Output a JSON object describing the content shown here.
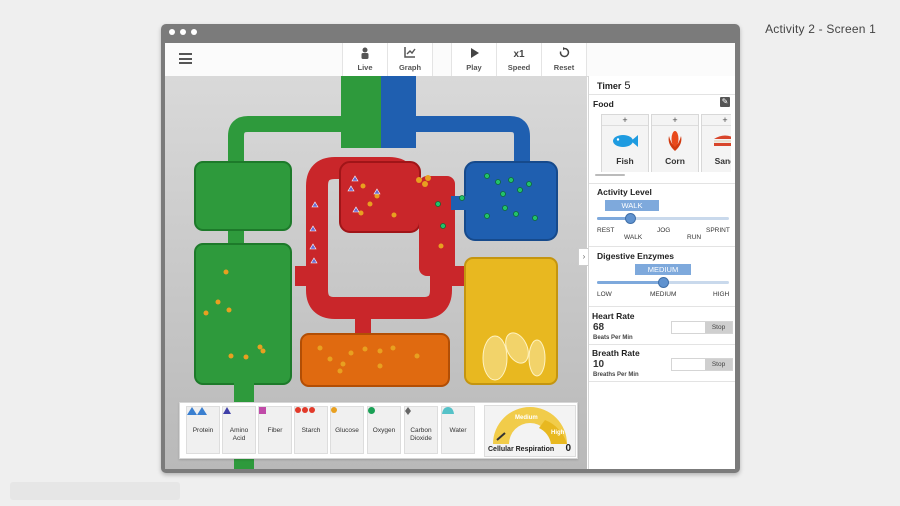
{
  "screen_label": "Activity 2 - Screen 1",
  "toolbar": {
    "live": "Live",
    "graph": "Graph",
    "play": "Play",
    "speed_value": "x1",
    "speed": "Speed",
    "reset": "Reset"
  },
  "panel": {
    "timer_label": "Timer",
    "timer_value": "5",
    "food_title": "Food",
    "foods": [
      {
        "name": "Fish",
        "plus": "+",
        "icon": "fish-icon",
        "color": "#1e9be0"
      },
      {
        "name": "Corn",
        "plus": "+",
        "icon": "corn-icon",
        "color": "#e84a1c"
      },
      {
        "name": "Sand",
        "plus": "+",
        "icon": "sandwich-icon",
        "color": "#d8452b"
      }
    ],
    "activity": {
      "title": "Activity Level",
      "value": "WALK",
      "ticks": [
        "REST",
        "JOG",
        "SPRINT"
      ],
      "ticks_lower": [
        "WALK",
        "RUN"
      ],
      "level": 0.25
    },
    "enzymes": {
      "title": "Digestive Enzymes",
      "value": "MEDIUM",
      "ticks": [
        "LOW",
        "MEDIUM",
        "HIGH"
      ],
      "level": 0.5
    },
    "heart": {
      "title": "Heart Rate",
      "value": "68",
      "unit": "Beats Per Min",
      "stop": "Stop"
    },
    "breath": {
      "title": "Breath Rate",
      "value": "10",
      "unit": "Breaths Per Min",
      "stop": "Stop"
    }
  },
  "legend": {
    "items": [
      {
        "label": "Protein",
        "color": "#3a7fd0",
        "icon": "protein-icon"
      },
      {
        "label": "Amino Acid",
        "color": "#3f3fa8",
        "icon": "amino-acid-icon"
      },
      {
        "label": "Fiber",
        "color": "#c04aa8",
        "icon": "fiber-icon"
      },
      {
        "label": "Starch",
        "color": "#e23a2a",
        "icon": "starch-icon"
      },
      {
        "label": "Glucose",
        "color": "#e8a020",
        "icon": "glucose-icon"
      },
      {
        "label": "Oxygen",
        "color": "#1aa055",
        "icon": "oxygen-icon"
      },
      {
        "label": "Carbon Dioxide",
        "color": "#666666",
        "icon": "carbon-dioxide-icon"
      },
      {
        "label": "Water",
        "color": "#55c2c8",
        "icon": "water-icon"
      }
    ],
    "gauge": {
      "label": "Cellular Respiration",
      "value": "0",
      "band_medium": "Medium",
      "band_high": "High"
    }
  },
  "colors": {
    "lungs": "#2e9a3c",
    "heart": "#c9262a",
    "blood": "#1f5fb0",
    "digestion": "#e06a10",
    "muscle": "#e8b820"
  }
}
